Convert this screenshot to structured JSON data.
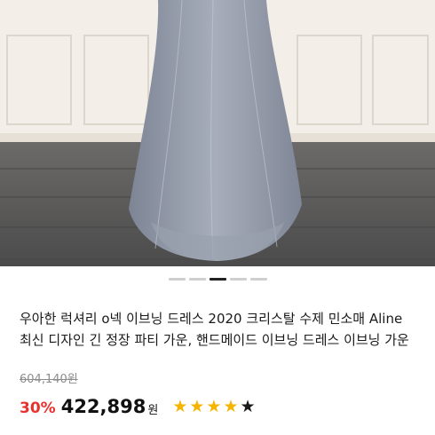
{
  "product": {
    "title": "우아한 럭셔리 o넥 이브닝 드레스 2020 크리스탈 수제 민소매 Aline 최신 디자인 긴 정장 파티 가운, 핸드메이드 이브닝 드레스 이브닝 가운",
    "original_price": "604,140원",
    "discount": "30%",
    "sale_price": "422,898",
    "currency": "원"
  },
  "image": {
    "subject": "grey tulle evening gown",
    "wall_color": "#f3efe8",
    "floor_color": "#555353",
    "dress_color": "#8f97a6"
  },
  "carousel": {
    "dot_count": 5,
    "active_index": 2
  },
  "rating": {
    "stars_filled": 4,
    "stars_total": 5
  },
  "colors": {
    "discount": "#e8322f",
    "star_filled": "#f4b400",
    "star_empty": "#1a1a1a"
  },
  "icons": {
    "star": "star-icon"
  }
}
